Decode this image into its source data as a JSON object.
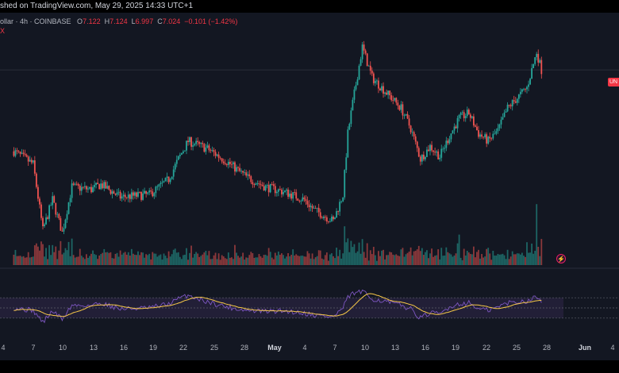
{
  "header": {
    "published": "shed on TradingView.com, May 29, 2025 14:33 UTC+1"
  },
  "legend": {
    "symbol": "ollar · 4h · COINBASE",
    "open_key": "O",
    "open": "7.122",
    "high_key": "H",
    "high": "7.124",
    "low_key": "L",
    "low": "6.997",
    "close_key": "C",
    "close": "7.024",
    "change": "−0.101 (−1.42%)",
    "badge": "X"
  },
  "price_tag": "UN",
  "bolt_icon": "⚡",
  "colors": {
    "up": "#26a69a",
    "down": "#ef5350",
    "rsi_line": "#7e57c2",
    "rsi_ma": "#f7c948",
    "rsi_band": "#2a2440",
    "background": "#131722"
  },
  "chart_data": {
    "type": "candlestick",
    "timeframe": "4h",
    "price_range": [
      5.0,
      9.6
    ],
    "x_tick_labels": [
      "4",
      "7",
      "10",
      "13",
      "16",
      "19",
      "22",
      "25",
      "28",
      "May",
      "4",
      "7",
      "10",
      "13",
      "16",
      "19",
      "22",
      "25",
      "28",
      "Jun",
      "4"
    ],
    "close_path": [
      {
        "day": 0,
        "close": 7.25
      },
      {
        "day": 2,
        "close": 7.0
      },
      {
        "day": 3,
        "close": 5.7
      },
      {
        "day": 4,
        "close": 6.3
      },
      {
        "day": 5,
        "close": 5.65
      },
      {
        "day": 6,
        "close": 6.55
      },
      {
        "day": 8,
        "close": 6.5
      },
      {
        "day": 9,
        "close": 6.6
      },
      {
        "day": 11,
        "close": 6.35
      },
      {
        "day": 14,
        "close": 6.4
      },
      {
        "day": 16,
        "close": 6.7
      },
      {
        "day": 17,
        "close": 7.1
      },
      {
        "day": 18,
        "close": 7.45
      },
      {
        "day": 20,
        "close": 7.3
      },
      {
        "day": 22,
        "close": 7.05
      },
      {
        "day": 24,
        "close": 6.75
      },
      {
        "day": 26,
        "close": 6.55
      },
      {
        "day": 28,
        "close": 6.45
      },
      {
        "day": 30,
        "close": 6.3
      },
      {
        "day": 31,
        "close": 6.1
      },
      {
        "day": 33,
        "close": 5.88
      },
      {
        "day": 34,
        "close": 6.4
      },
      {
        "day": 34.5,
        "close": 7.6
      },
      {
        "day": 35,
        "close": 8.2
      },
      {
        "day": 36,
        "close": 9.3
      },
      {
        "day": 37,
        "close": 8.7
      },
      {
        "day": 39,
        "close": 8.3
      },
      {
        "day": 40,
        "close": 8.1
      },
      {
        "day": 41,
        "close": 7.7
      },
      {
        "day": 42,
        "close": 7.1
      },
      {
        "day": 43,
        "close": 7.35
      },
      {
        "day": 44,
        "close": 7.15
      },
      {
        "day": 45,
        "close": 7.55
      },
      {
        "day": 46,
        "close": 7.9
      },
      {
        "day": 47,
        "close": 8.0
      },
      {
        "day": 48,
        "close": 7.6
      },
      {
        "day": 49,
        "close": 7.45
      },
      {
        "day": 50,
        "close": 7.65
      },
      {
        "day": 51,
        "close": 8.1
      },
      {
        "day": 52,
        "close": 8.3
      },
      {
        "day": 53,
        "close": 8.5
      },
      {
        "day": 54,
        "close": 9.2
      },
      {
        "day": 54.5,
        "close": 8.85
      }
    ],
    "volume_spikes": [
      {
        "day": 54,
        "value": 3.2
      },
      {
        "day": 34.5,
        "value": 1.4
      },
      {
        "day": 46,
        "value": 1.6
      },
      {
        "day": 3,
        "value": 1.1
      },
      {
        "day": 53,
        "value": 1.2
      }
    ],
    "rsi_range": [
      0,
      100
    ],
    "rsi_band": [
      30,
      70
    ],
    "rsi_path": [
      {
        "day": 0,
        "value": 50
      },
      {
        "day": 2,
        "value": 45
      },
      {
        "day": 3,
        "value": 22
      },
      {
        "day": 4,
        "value": 44
      },
      {
        "day": 5,
        "value": 28
      },
      {
        "day": 6,
        "value": 55
      },
      {
        "day": 8,
        "value": 55
      },
      {
        "day": 9,
        "value": 60
      },
      {
        "day": 11,
        "value": 48
      },
      {
        "day": 14,
        "value": 50
      },
      {
        "day": 16,
        "value": 58
      },
      {
        "day": 17,
        "value": 68
      },
      {
        "day": 18,
        "value": 75
      },
      {
        "day": 20,
        "value": 62
      },
      {
        "day": 22,
        "value": 52
      },
      {
        "day": 24,
        "value": 45
      },
      {
        "day": 26,
        "value": 43
      },
      {
        "day": 28,
        "value": 44
      },
      {
        "day": 30,
        "value": 40
      },
      {
        "day": 31,
        "value": 36
      },
      {
        "day": 33,
        "value": 32
      },
      {
        "day": 34,
        "value": 50
      },
      {
        "day": 34.5,
        "value": 70
      },
      {
        "day": 35,
        "value": 78
      },
      {
        "day": 36,
        "value": 82
      },
      {
        "day": 37,
        "value": 68
      },
      {
        "day": 39,
        "value": 60
      },
      {
        "day": 40,
        "value": 55
      },
      {
        "day": 41,
        "value": 48
      },
      {
        "day": 42,
        "value": 30
      },
      {
        "day": 43,
        "value": 40
      },
      {
        "day": 44,
        "value": 38
      },
      {
        "day": 45,
        "value": 52
      },
      {
        "day": 46,
        "value": 58
      },
      {
        "day": 47,
        "value": 60
      },
      {
        "day": 48,
        "value": 48
      },
      {
        "day": 49,
        "value": 45
      },
      {
        "day": 50,
        "value": 52
      },
      {
        "day": 51,
        "value": 60
      },
      {
        "day": 52,
        "value": 62
      },
      {
        "day": 53,
        "value": 64
      },
      {
        "day": 54,
        "value": 72
      },
      {
        "day": 54.5,
        "value": 63
      }
    ],
    "grid": false,
    "legend_position": "top-left"
  }
}
